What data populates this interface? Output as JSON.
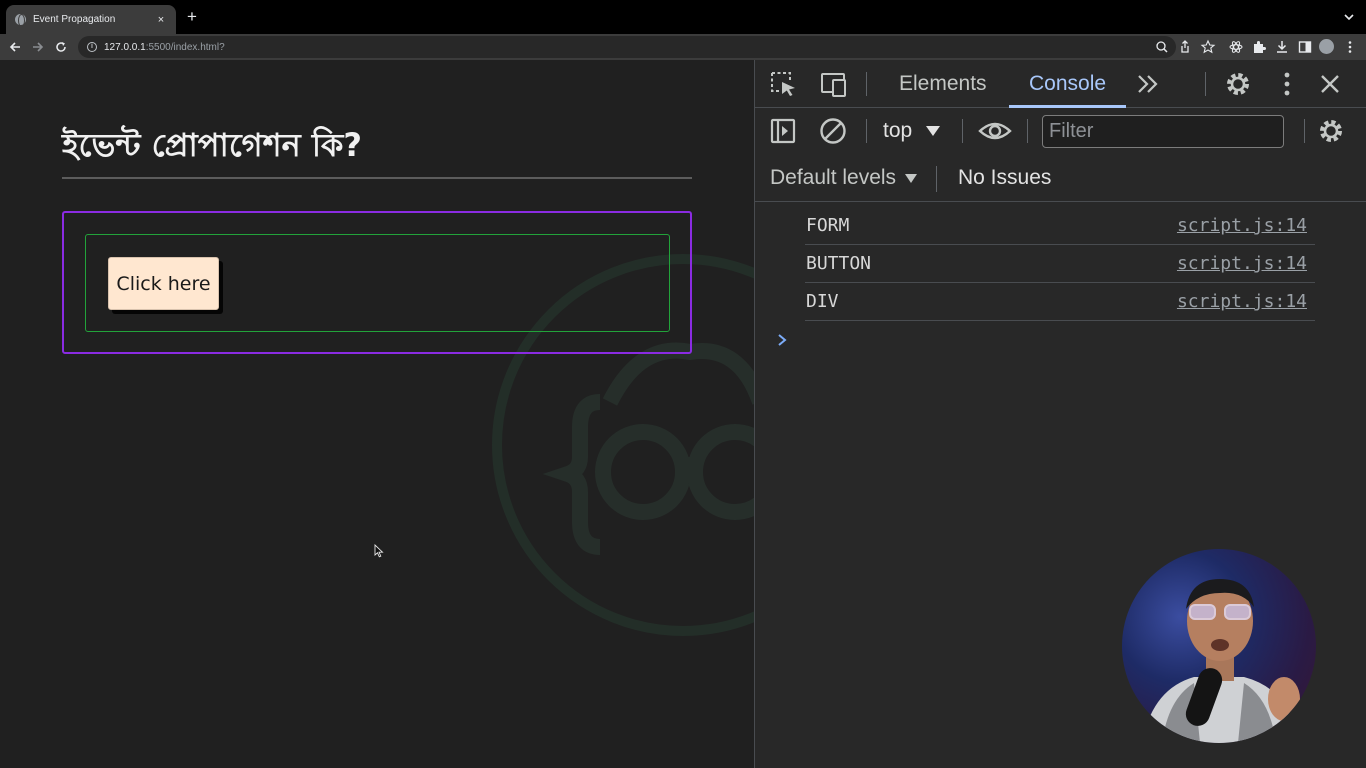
{
  "browser": {
    "tab_title": "Event Propagation",
    "tab_close": "×",
    "new_tab": "+",
    "url_host": "127.0.0.1",
    "url_rest": ":5500/index.html?"
  },
  "page": {
    "heading": "ইভেন্ট প্রোপাগেশন কি?",
    "button_label": "Click here",
    "div_border_color": "#8a2be2",
    "form_border_color": "#22a33a"
  },
  "devtools": {
    "tabs": [
      {
        "label": "Elements",
        "active": false
      },
      {
        "label": "Console",
        "active": true
      }
    ],
    "context": "top",
    "filter_placeholder": "Filter",
    "levels": "Default levels",
    "issues": "No Issues",
    "accent_color": "#a8c7fa",
    "console_messages": [
      {
        "text": "FORM",
        "source": "script.js:14"
      },
      {
        "text": "BUTTON",
        "source": "script.js:14"
      },
      {
        "text": "DIV",
        "source": "script.js:14"
      }
    ]
  }
}
